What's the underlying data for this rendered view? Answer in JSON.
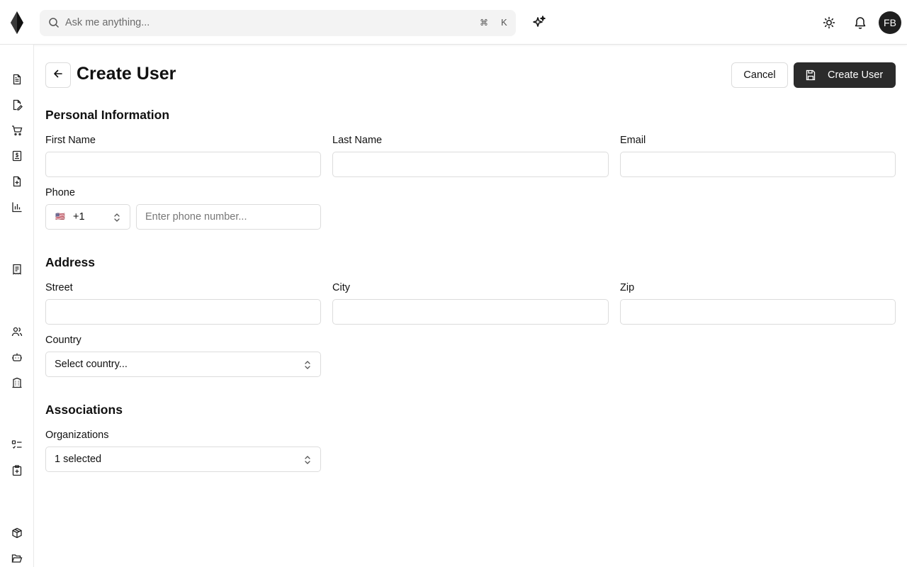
{
  "topbar": {
    "search_placeholder": "Ask me anything...",
    "shortcut_modifier": "⌘",
    "shortcut_key": "K",
    "avatar_initials": "FB"
  },
  "sidebar": {
    "icons": [
      "document-icon",
      "document-edit-icon",
      "cart-icon",
      "invoice-icon",
      "file-plus-icon",
      "bar-chart-icon",
      "receipt-icon",
      "users-icon",
      "bot-icon",
      "building-icon",
      "checklist-icon",
      "clipboard-plus-icon",
      "package-icon",
      "folder-open-icon"
    ]
  },
  "header": {
    "title": "Create User",
    "cancel_label": "Cancel",
    "create_label": "Create User"
  },
  "personal": {
    "section_title": "Personal Information",
    "first_name_label": "First Name",
    "first_name_value": "",
    "last_name_label": "Last Name",
    "last_name_value": "",
    "email_label": "Email",
    "email_value": "",
    "phone_label": "Phone",
    "phone_flag": "🇺🇸",
    "phone_country_code": "+1",
    "phone_placeholder": "Enter phone number..."
  },
  "address": {
    "section_title": "Address",
    "street_label": "Street",
    "street_value": "",
    "city_label": "City",
    "city_value": "",
    "zip_label": "Zip",
    "zip_value": "",
    "country_label": "Country",
    "country_placeholder": "Select country..."
  },
  "associations": {
    "section_title": "Associations",
    "organizations_label": "Organizations",
    "organizations_value": "1 selected"
  },
  "colors": {
    "primary_button": "#2b2b2b",
    "border": "#dcdcdc",
    "search_bg": "#f3f3f3"
  }
}
